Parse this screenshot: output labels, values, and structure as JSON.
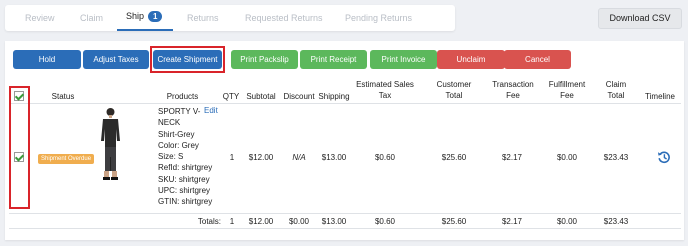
{
  "tabs": [
    {
      "label": "Review"
    },
    {
      "label": "Claim"
    },
    {
      "label": "Ship",
      "count": "1"
    },
    {
      "label": "Returns"
    },
    {
      "label": "Requested Returns"
    },
    {
      "label": "Pending Returns"
    }
  ],
  "download_csv": "Download CSV",
  "actions": {
    "hold": "Hold",
    "adjust_taxes": "Adjust Taxes",
    "create_shipment": "Create Shipment",
    "print_packslip": "Print Packslip",
    "print_receipt": "Print Receipt",
    "print_invoice": "Print Invoice",
    "unclaim": "Unclaim",
    "cancel": "Cancel"
  },
  "columns": {
    "status": "Status",
    "products": "Products",
    "qty": "QTY",
    "subtotal": "Subtotal",
    "discount": "Discount",
    "shipping": "Shipping",
    "tax_1": "Estimated Sales",
    "tax_2": "Tax",
    "customer_1": "Customer",
    "customer_2": "Total",
    "transaction_1": "Transaction",
    "transaction_2": "Fee",
    "fulfillment_1": "Fulfillment",
    "fulfillment_2": "Fee",
    "claim_1": "Claim",
    "claim_2": "Total",
    "timeline": "Timeline"
  },
  "row": {
    "status": "Shipment Overdue",
    "product_lines": [
      "SPORTY V-",
      "NECK",
      "Shirt-Grey",
      "Color: Grey",
      "Size: S",
      "RefId: shirtgrey",
      "SKU: shirtgrey",
      "UPC: shirtgrey",
      "GTIN: shirtgrey"
    ],
    "edit": "Edit",
    "qty": "1",
    "subtotal": "$12.00",
    "discount": "N/A",
    "shipping": "$13.00",
    "tax": "$0.60",
    "customer_total": "$25.60",
    "transaction_fee": "$2.17",
    "fulfillment_fee": "$0.00",
    "claim_total": "$23.43"
  },
  "totals": {
    "label": "Totals:",
    "qty": "1",
    "subtotal": "$12.00",
    "discount": "$0.00",
    "shipping": "$13.00",
    "tax": "$0.60",
    "customer_total": "$25.60",
    "transaction_fee": "$2.17",
    "fulfillment_fee": "$0.00",
    "claim_total": "$23.43"
  },
  "colors": {
    "primary": "#2b6db8",
    "success": "#5cb85c",
    "danger": "#d9534f",
    "warning": "#f0ad4e",
    "highlight": "#d9242a"
  }
}
